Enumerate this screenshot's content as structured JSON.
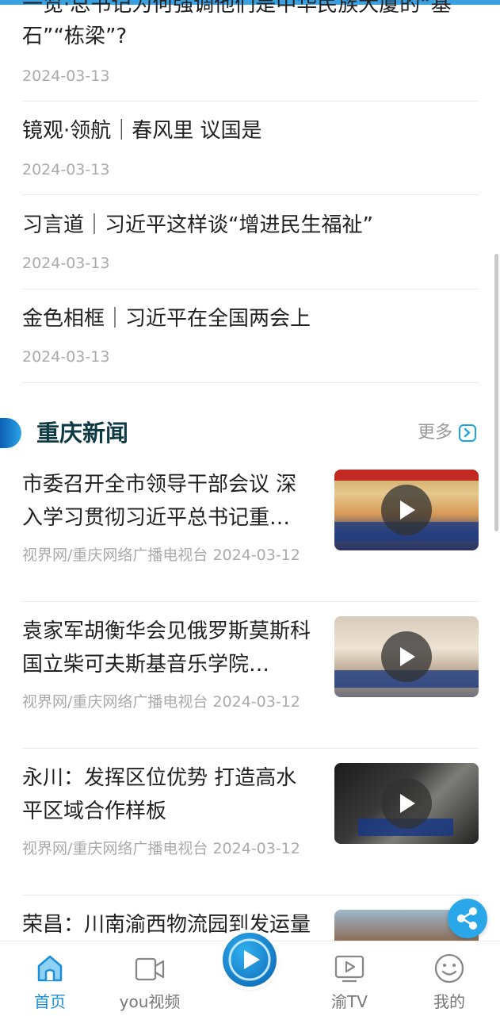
{
  "top_list": [
    {
      "title": "一览·总书记为何强调他们是中华民族大厦的“基石”“栋梁”?",
      "date": "2024-03-13"
    },
    {
      "title": "镜观·领航｜春风里 议国是",
      "date": "2024-03-13"
    },
    {
      "title": "习言道｜习近平这样谈“增进民生福祉”",
      "date": "2024-03-13"
    },
    {
      "title": "金色相框｜习近平在全国两会上",
      "date": "2024-03-13"
    }
  ],
  "section": {
    "title": "重庆新闻",
    "more_label": "更多"
  },
  "news": [
    {
      "title": "市委召开全市领导干部会议 深入学习贯彻习近平总书记重…",
      "meta": "视界网/重庆网络广播电视台   2024-03-12"
    },
    {
      "title": "袁家军胡衡华会见俄罗斯莫斯科国立柴可夫斯基音乐学院…",
      "meta": "视界网/重庆网络广播电视台   2024-03-12"
    },
    {
      "title": "永川：发挥区位优势 打造高水平区域合作样板",
      "meta": "视界网/重庆网络广播电视台   2024-03-12"
    },
    {
      "title": "荣昌：川南渝西物流园到发运量突破万吨",
      "meta": ""
    }
  ],
  "tabs": [
    {
      "label": "首页",
      "icon": "home-icon",
      "active": true
    },
    {
      "label": "you视频",
      "icon": "video-camera-icon",
      "active": false
    },
    {
      "label": "渝TV",
      "icon": "tv-icon",
      "active": false
    },
    {
      "label": "我的",
      "icon": "smiley-icon",
      "active": false
    }
  ],
  "colors": {
    "accent": "#1a8fd8",
    "section_title": "#0e3a44",
    "muted": "#aaaaaa"
  }
}
